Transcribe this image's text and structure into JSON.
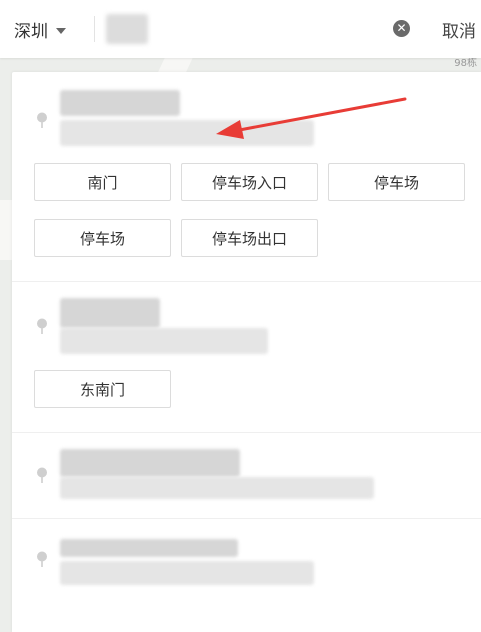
{
  "header": {
    "city": "深圳",
    "search_placeholder": "",
    "cancel_label": "取消"
  },
  "map": {
    "corner_label": "98栋"
  },
  "results": [
    {
      "sub_points": [
        "南门",
        "停车场入口",
        "停车场",
        "停车场",
        "停车场出口"
      ]
    },
    {
      "sub_points": [
        "东南门"
      ]
    },
    {
      "sub_points": []
    },
    {
      "sub_points": []
    }
  ],
  "colors": {
    "annotation_arrow": "#e83c36",
    "pin": "#cfcfcf",
    "button_border": "#dcdcdc"
  }
}
